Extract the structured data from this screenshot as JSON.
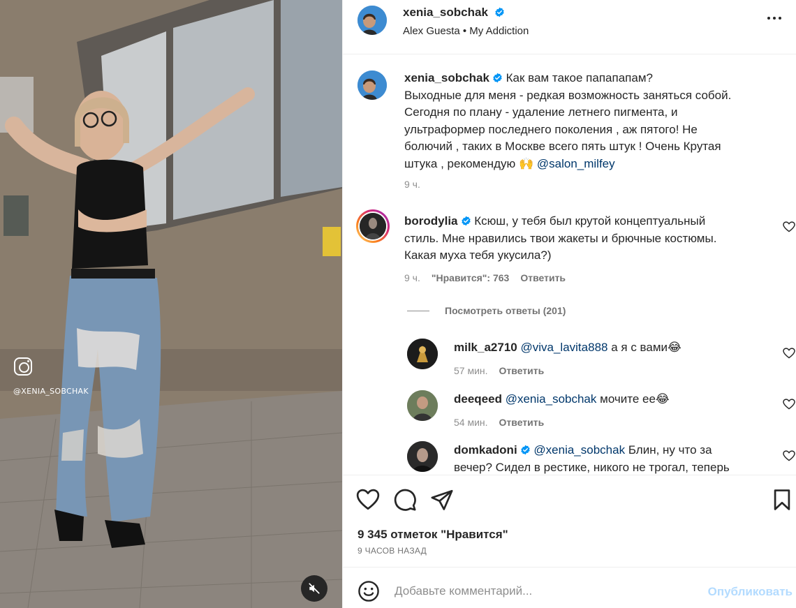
{
  "media": {
    "watermark_text": "@XENIA_SOBCHAK",
    "mute_icon": "speaker-muted-icon"
  },
  "header": {
    "username": "xenia_sobchak",
    "audio": "Alex Guesta • My Addiction",
    "more_icon": "more-horizontal-icon"
  },
  "caption": {
    "username": "xenia_sobchak",
    "text_lines": [
      "Как вам такое папапапам?",
      "Выходные для меня - редкая возможность заняться собой.",
      "Сегодня по плану - удаление летнего пигмента, и",
      "ультраформер последнего поколения , аж пятого! Не",
      "болючий , таких в Москве всего пять штук ! Очень Крутая",
      "штука , рекомендую 🙌"
    ],
    "mention": "@salon_milfey",
    "time": "9 ч."
  },
  "comments": [
    {
      "username": "borodylia",
      "verified": true,
      "lines": [
        "Ксюш, у тебя был крутой концептуальный",
        "стиль. Мне нравились твои жакеты и брючные костюмы.",
        "Какая муха тебя укусила?)"
      ],
      "time": "9 ч.",
      "likes": "\"Нравится\": 763",
      "reply": "Ответить"
    }
  ],
  "view_replies": "Посмотреть ответы (201)",
  "replies": [
    {
      "username": "milk_a2710",
      "mention": "@viva_lavita888",
      "text": "а я с вами😂",
      "time": "57 мин.",
      "reply": "Ответить"
    },
    {
      "username": "deeqeed",
      "mention": "@xenia_sobchak",
      "text": "мочите ее😂",
      "time": "54 мин.",
      "reply": "Ответить"
    },
    {
      "username": "domkadoni",
      "verified": true,
      "mention": "@xenia_sobchak",
      "text": "Блин, ну что за",
      "text2": "вечер? Сидел в рестике, никого не трогал, теперь"
    }
  ],
  "actions": {
    "likes_text": "9 345 отметок \"Нравится\"",
    "time_ago": "9 ЧАСОВ НАЗАД"
  },
  "add_comment": {
    "placeholder": "Добавьте комментарий...",
    "publish": "Опубликовать"
  },
  "colors": {
    "mention": "#00376b",
    "verified": "#0095f6",
    "publish_disabled": "#b3dbff",
    "story_ring": "#d6249f"
  }
}
